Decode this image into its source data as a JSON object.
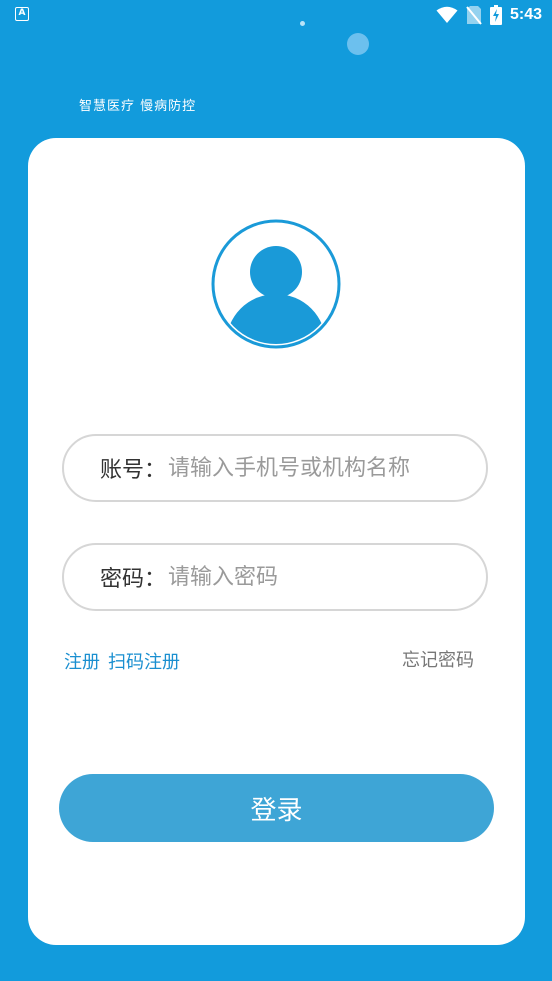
{
  "status_bar": {
    "app_icon_letter": "A",
    "time": "5:43",
    "icons": [
      "wifi-icon",
      "no-sim-icon",
      "battery-charging-icon"
    ]
  },
  "slogan": "智慧医疗 慢病防控",
  "form": {
    "account_label": "账号：",
    "account_placeholder": "请输入手机号或机构名称",
    "account_value": "",
    "password_label": "密码：",
    "password_placeholder": "请输入密码",
    "password_value": ""
  },
  "links": {
    "register": "注册",
    "scan_register": "扫码注册",
    "forgot_password": "忘记密码"
  },
  "login_button": "登录",
  "colors": {
    "background": "#129bdc",
    "accent": "#1a8fd0",
    "button": "#3ea5d6",
    "avatar": "#1a9ad8"
  }
}
